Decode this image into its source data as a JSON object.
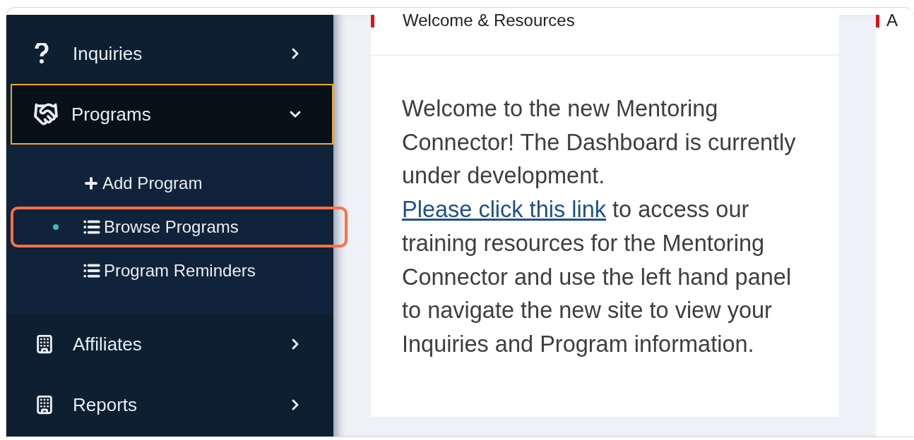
{
  "sidebar": {
    "items": [
      {
        "label": "Inquiries",
        "kind": "question",
        "expanded": false,
        "selected": false
      },
      {
        "label": "Programs",
        "kind": "handshake",
        "expanded": true,
        "selected": true,
        "children": [
          {
            "label": "Add Program",
            "kind": "plus",
            "selected": false,
            "highlighted": false
          },
          {
            "label": "Browse Programs",
            "kind": "list",
            "selected": true,
            "highlighted": true
          },
          {
            "label": "Program Reminders",
            "kind": "list",
            "selected": false,
            "highlighted": false
          }
        ]
      },
      {
        "label": "Affiliates",
        "kind": "building",
        "expanded": false,
        "selected": false
      },
      {
        "label": "Reports",
        "kind": "building",
        "expanded": false,
        "selected": false
      }
    ]
  },
  "card": {
    "title": "Welcome & Resources",
    "body_before": "Welcome to the new Mentoring Connector! The Dashboard is currently under development.",
    "link": "Please click this link",
    "body_after": "to access our training resources for the Mentoring Connector and use the left hand panel to navigate the new site to view your Inquiries and Program information."
  },
  "side_card": {
    "title": "A"
  }
}
